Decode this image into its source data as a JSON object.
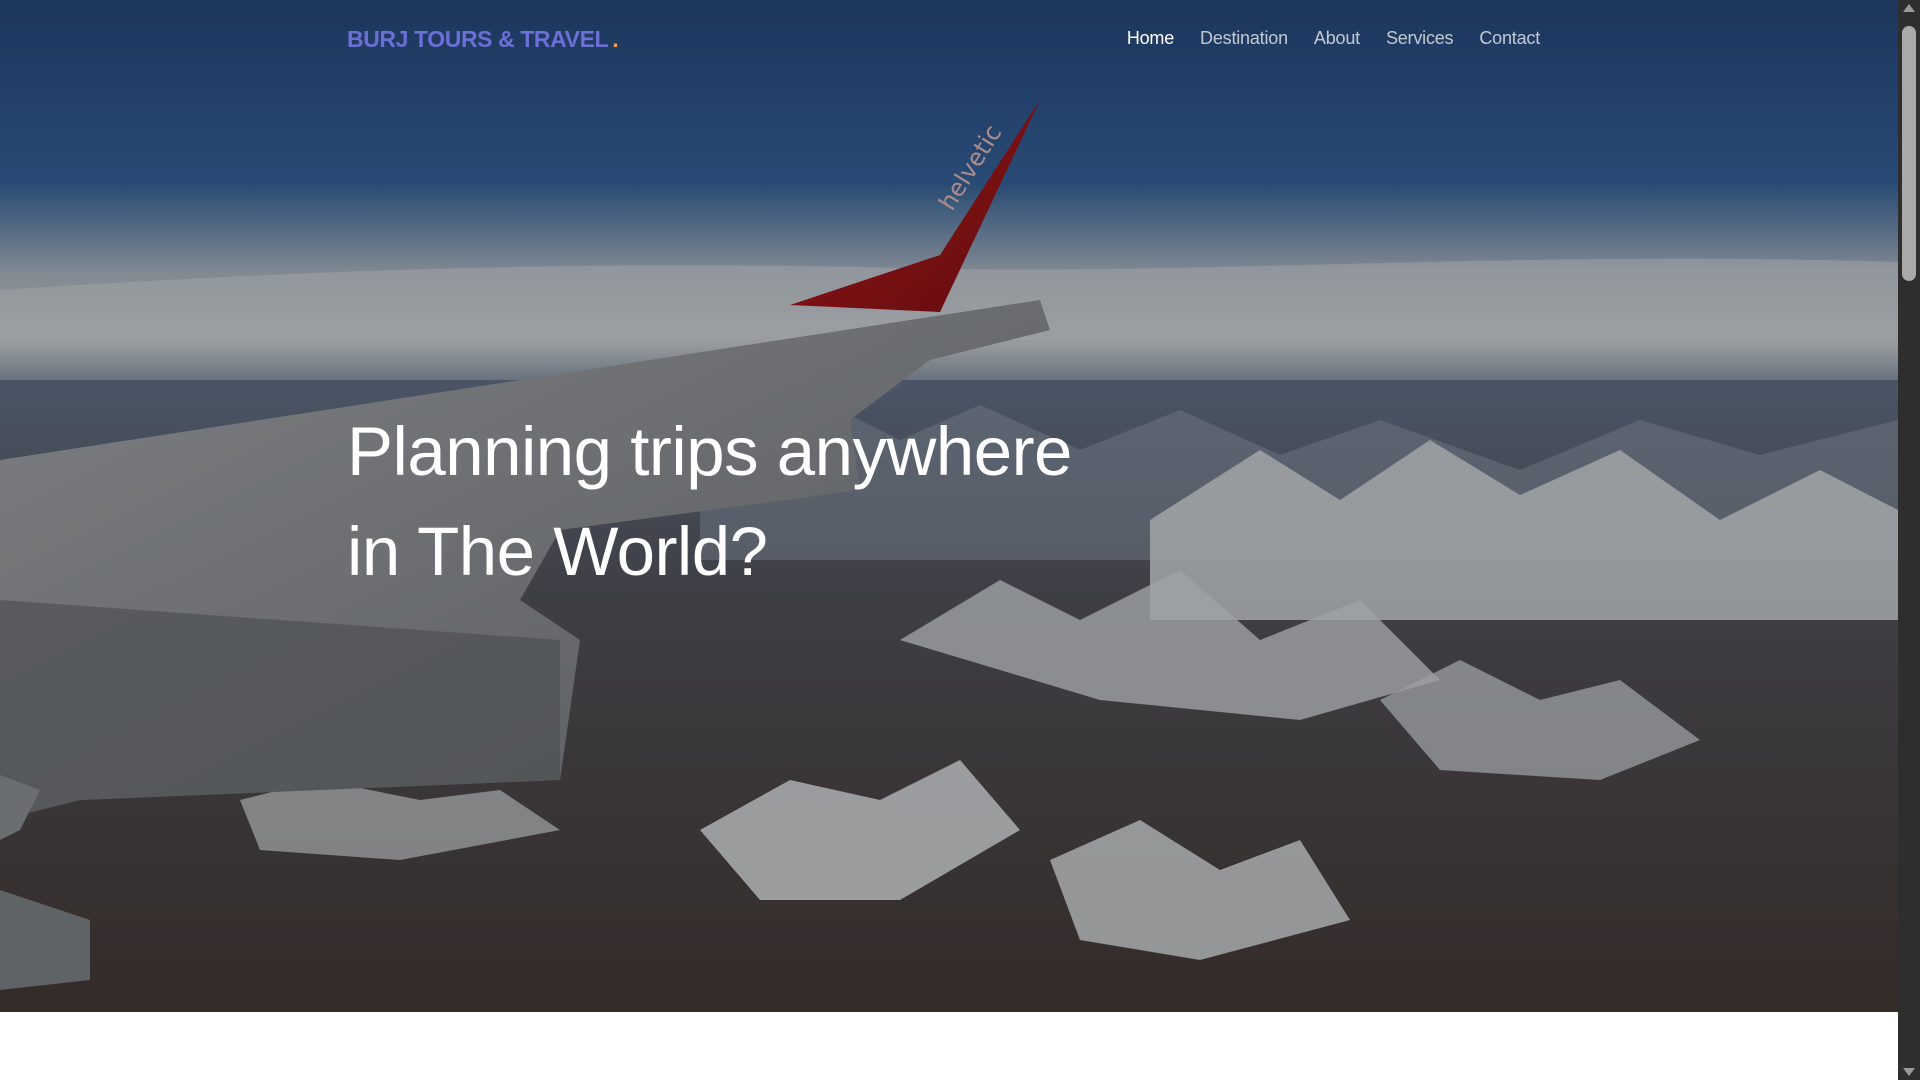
{
  "navbar": {
    "brand_text": "BURJ TOURS & TRAVEL",
    "brand_dot": ".",
    "brand_color": "#6b6fd6",
    "brand_dot_color": "#f39c52",
    "links": [
      {
        "label": "Home",
        "active": true
      },
      {
        "label": "Destination",
        "active": false
      },
      {
        "label": "About",
        "active": false
      },
      {
        "label": "Services",
        "active": false
      },
      {
        "label": "Contact",
        "active": false
      }
    ]
  },
  "hero": {
    "heading_line1": "Planning trips anywhere",
    "heading_line2": "in The World?",
    "wing_text": "helvetic",
    "background_image": "airplane-wing-over-snowy-mountains"
  }
}
